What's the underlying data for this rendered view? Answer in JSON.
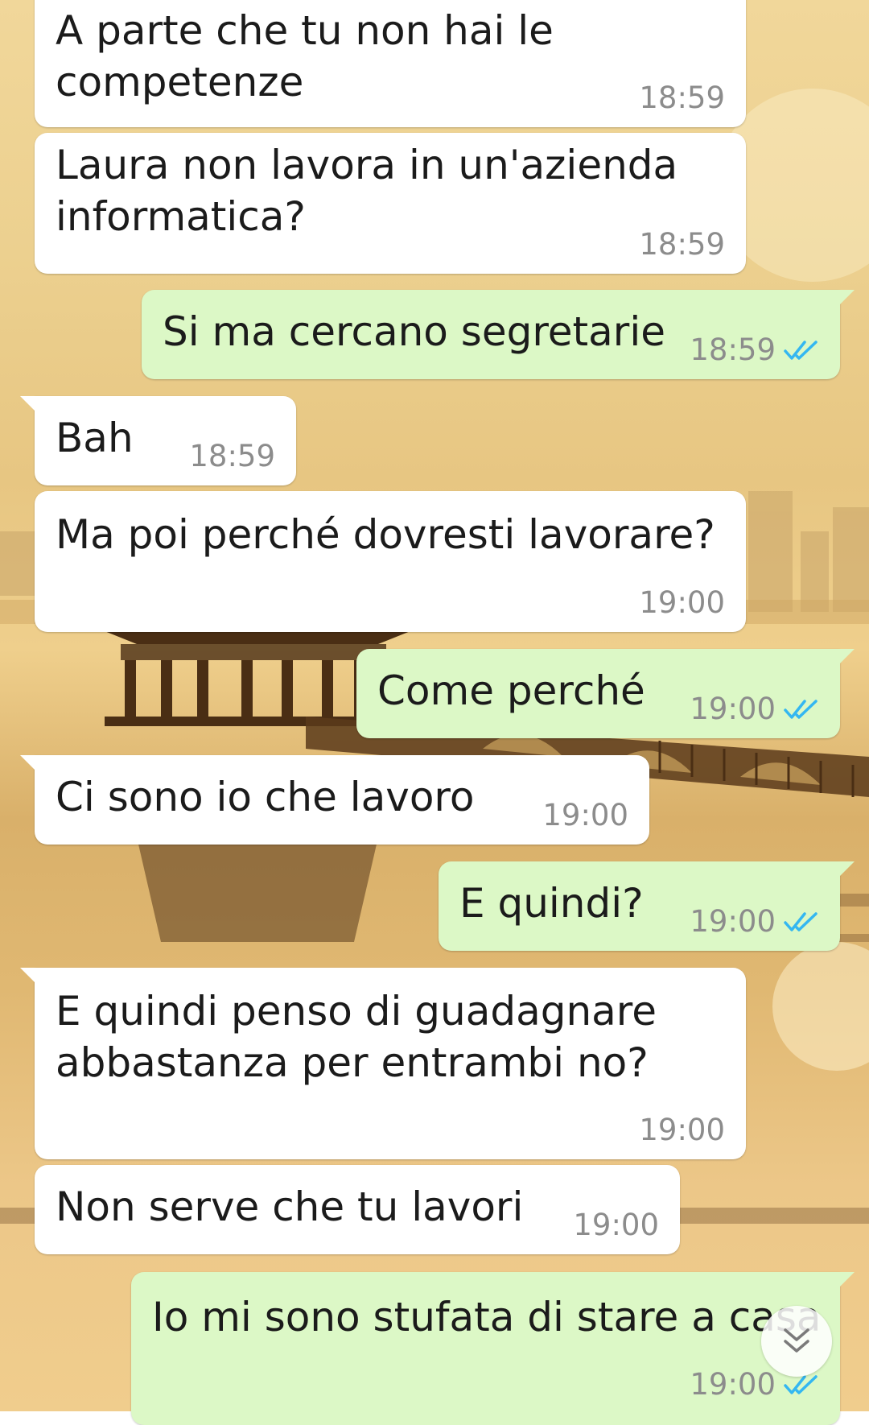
{
  "chat": {
    "messages": [
      {
        "direction": "incoming",
        "text": "A parte che tu non hai le\ncompetenze",
        "time": "18:59"
      },
      {
        "direction": "incoming",
        "text": "Laura non lavora in un'azienda\ninformatica?",
        "time": "18:59"
      },
      {
        "direction": "outgoing",
        "text": "Si ma cercano segretarie",
        "time": "18:59",
        "status": "read"
      },
      {
        "direction": "incoming",
        "text": "Bah",
        "time": "18:59"
      },
      {
        "direction": "incoming",
        "text": "Ma poi perché dovresti lavorare?",
        "time": "19:00"
      },
      {
        "direction": "outgoing",
        "text": "Come perché",
        "time": "19:00",
        "status": "read"
      },
      {
        "direction": "incoming",
        "text": "Ci sono io che lavoro",
        "time": "19:00"
      },
      {
        "direction": "outgoing",
        "text": "E quindi?",
        "time": "19:00",
        "status": "read"
      },
      {
        "direction": "incoming",
        "text": "E quindi penso di guadagnare\nabbastanza per entrambi no?",
        "time": "19:00"
      },
      {
        "direction": "incoming",
        "text": "Non serve che tu lavori",
        "time": "19:00"
      },
      {
        "direction": "outgoing",
        "text": "Io mi sono stufata di stare a casa",
        "time": "19:00",
        "status": "read"
      }
    ]
  },
  "scroll_button": {
    "icon": "double-chevron-down-icon"
  },
  "colors": {
    "incoming_bubble": "#ffffff",
    "outgoing_bubble": "#dcf8c6",
    "read_ticks": "#34b7f1",
    "timestamp": "#8c8c8c"
  }
}
